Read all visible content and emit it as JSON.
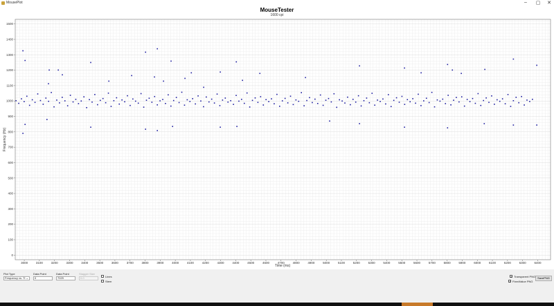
{
  "window": {
    "title": "MousePlot",
    "minimize": "–",
    "maximize": "▢",
    "close": "✕"
  },
  "controls": {
    "plot_type_label": "Plot Type",
    "plot_type_value": "Frequency vs. Ti",
    "start_label": "Data Point",
    "start_value": "0",
    "end_label": "Data Point",
    "end_value": "7029",
    "stagger_label": "Stagger Size",
    "stagger_value": "0.0",
    "lines_label": "Lines",
    "lines_checked": false,
    "stem_label": "Stem",
    "stem_checked": false,
    "transparent_label": "Transparent PNG",
    "transparent_checked": true,
    "fixed_label": "FixedValue PNG",
    "fixed_checked": true,
    "save_label": "SavePNG"
  },
  "chart_data": {
    "type": "scatter",
    "title": "MouseTester",
    "subtitle": "1600 cpi",
    "xlabel": "Time (ms)",
    "ylabel": "Frequency (Hz)",
    "xlim": [
      2940,
      6485
    ],
    "ylim": [
      -30,
      1530
    ],
    "xticks": [
      3000,
      3100,
      3200,
      3300,
      3400,
      3500,
      3600,
      3700,
      3800,
      3900,
      4000,
      4100,
      4200,
      4300,
      4400,
      4500,
      4600,
      4700,
      4800,
      4900,
      5000,
      5100,
      5200,
      5300,
      5400,
      5500,
      5600,
      5700,
      5800,
      5900,
      6000,
      6100,
      6200,
      6300,
      6400
    ],
    "yticks": [
      0,
      100,
      200,
      300,
      400,
      500,
      600,
      700,
      800,
      900,
      1000,
      1100,
      1200,
      1300,
      1400,
      1500
    ],
    "grid": true,
    "marker_color": "#1c1ca0",
    "core_x_start": 2945,
    "core_x_step": 18,
    "core_y": [
      1002,
      985,
      1014,
      996,
      1031,
      972,
      1008,
      991,
      1046,
      1003,
      979,
      1019,
      998,
      1055,
      962,
      1006,
      988,
      1024,
      1001,
      969,
      1037,
      994,
      1011,
      983,
      1000,
      1027,
      957,
      1009,
      993,
      1042,
      976,
      1004,
      1016,
      989,
      1051,
      965,
      1002,
      1021,
      980,
      1007,
      995,
      1034,
      971,
      1013,
      999,
      986,
      1048,
      960,
      1005,
      1018,
      992,
      1029,
      975,
      1001,
      1010,
      984,
      1040,
      967,
      1003,
      1023,
      990,
      1057,
      973,
      1008,
      997,
      1015,
      981,
      1033,
      1000,
      963,
      1026,
      994,
      1012,
      987,
      1045,
      970,
      1006,
      1019,
      993,
      1002,
      978,
      1036,
      999,
      1011,
      985,
      1052,
      961,
      1004,
      1020,
      991,
      1028,
      974,
      1009,
      996,
      1014,
      982,
      1043,
      966,
      1001,
      1017,
      988,
      1031,
      977,
      1007,
      998,
      1054,
      969,
      1003,
      1022,
      990,
      1012,
      984,
      1039,
      972,
      1005,
      1016,
      994,
      1047,
      959,
      1008,
      1000,
      987,
      1025,
      976,
      1011,
      993,
      1034,
      968,
      1002,
      1019,
      989,
      1050,
      973,
      1006,
      997,
      1013,
      981,
      1041,
      964,
      1004,
      1021,
      992,
      1030,
      978,
      1009,
      995,
      1015,
      986,
      1044,
      970,
      1001,
      1018,
      990,
      1056,
      962,
      1007,
      999,
      1012,
      983,
      1037,
      975,
      1005,
      1023,
      994,
      1027,
      967,
      1010,
      996,
      1016,
      985,
      1048,
      971,
      1003,
      1020,
      991,
      1033,
      979,
      1008,
      998,
      1014,
      982,
      1042,
      965,
      1002,
      1024,
      989,
      1029,
      974,
      1006,
      997,
      1011
    ],
    "outliers": [
      [
        2991,
        1326
      ],
      [
        3005,
        1263
      ],
      [
        2991,
        790
      ],
      [
        3005,
        848
      ],
      [
        3160,
        1112
      ],
      [
        3165,
        1201
      ],
      [
        3225,
        1201
      ],
      [
        3252,
        1170
      ],
      [
        3150,
        880
      ],
      [
        3440,
        1250
      ],
      [
        3440,
        830
      ],
      [
        3560,
        1129
      ],
      [
        3711,
        1165
      ],
      [
        3803,
        1317
      ],
      [
        3803,
        817
      ],
      [
        3862,
        1156
      ],
      [
        3881,
        1339
      ],
      [
        3922,
        1129
      ],
      [
        3881,
        808
      ],
      [
        3972,
        1259
      ],
      [
        3982,
        835
      ],
      [
        4064,
        1147
      ],
      [
        4106,
        1183
      ],
      [
        4188,
        1089
      ],
      [
        4298,
        830
      ],
      [
        4298,
        1188
      ],
      [
        4404,
        1254
      ],
      [
        4408,
        835
      ],
      [
        4445,
        1134
      ],
      [
        4560,
        1179
      ],
      [
        4862,
        1152
      ],
      [
        5022,
        870
      ],
      [
        5220,
        1228
      ],
      [
        5220,
        853
      ],
      [
        5518,
        1214
      ],
      [
        5518,
        830
      ],
      [
        5628,
        1183
      ],
      [
        5803,
        1237
      ],
      [
        5803,
        826
      ],
      [
        5835,
        1201
      ],
      [
        5894,
        1179
      ],
      [
        6050,
        1205
      ],
      [
        6046,
        853
      ],
      [
        6239,
        1272
      ],
      [
        6239,
        844
      ],
      [
        6394,
        1232
      ],
      [
        6394,
        844
      ]
    ]
  }
}
